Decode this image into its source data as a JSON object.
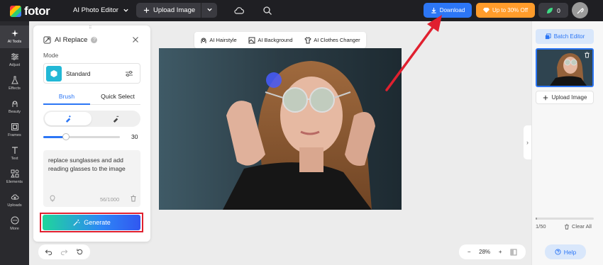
{
  "app": {
    "brand": "fotor",
    "editor_menu": "AI Photo Editor"
  },
  "topbar": {
    "upload_label": "Upload Image",
    "download_label": "Download",
    "promo_label": "Up to 30% Off",
    "credits": "0"
  },
  "sidebar": {
    "items": [
      {
        "label": "AI Tools",
        "icon": "sparkle-icon",
        "active": true
      },
      {
        "label": "Adjust",
        "icon": "sliders-icon"
      },
      {
        "label": "Effects",
        "icon": "flask-icon"
      },
      {
        "label": "Beauty",
        "icon": "face-icon"
      },
      {
        "label": "Frames",
        "icon": "frame-icon"
      },
      {
        "label": "Text",
        "icon": "text-icon"
      },
      {
        "label": "Elements",
        "icon": "elements-icon"
      },
      {
        "label": "Uploads",
        "icon": "upload-cloud-icon"
      },
      {
        "label": "More",
        "icon": "more-icon"
      }
    ]
  },
  "panel": {
    "title": "AI Replace",
    "mode_label": "Mode",
    "mode_value": "Standard",
    "tabs": [
      "Brush",
      "Quick Select"
    ],
    "brush_size": "30",
    "brush_size_fraction": 0.3,
    "prompt_text": "replace sunglasses and add reading glasses to the image",
    "char_count": "56/1000",
    "generate_label": "Generate"
  },
  "canvas_tools": {
    "items": [
      {
        "label": "AI Hairstyle",
        "icon": "hairstyle-icon"
      },
      {
        "label": "AI Background",
        "icon": "background-icon"
      },
      {
        "label": "AI Clothes Changer",
        "icon": "shirt-icon"
      }
    ]
  },
  "zoom": {
    "value": "28%"
  },
  "right_panel": {
    "batch_label": "Batch Editor",
    "upload_label": "Upload Image",
    "ratio": "1/50",
    "clear_label": "Clear All",
    "progress_fraction": 0.02
  },
  "help_label": "Help",
  "colors": {
    "accent": "#2c76f5",
    "promo": "#ff9c2b",
    "highlight": "#e0202f"
  }
}
